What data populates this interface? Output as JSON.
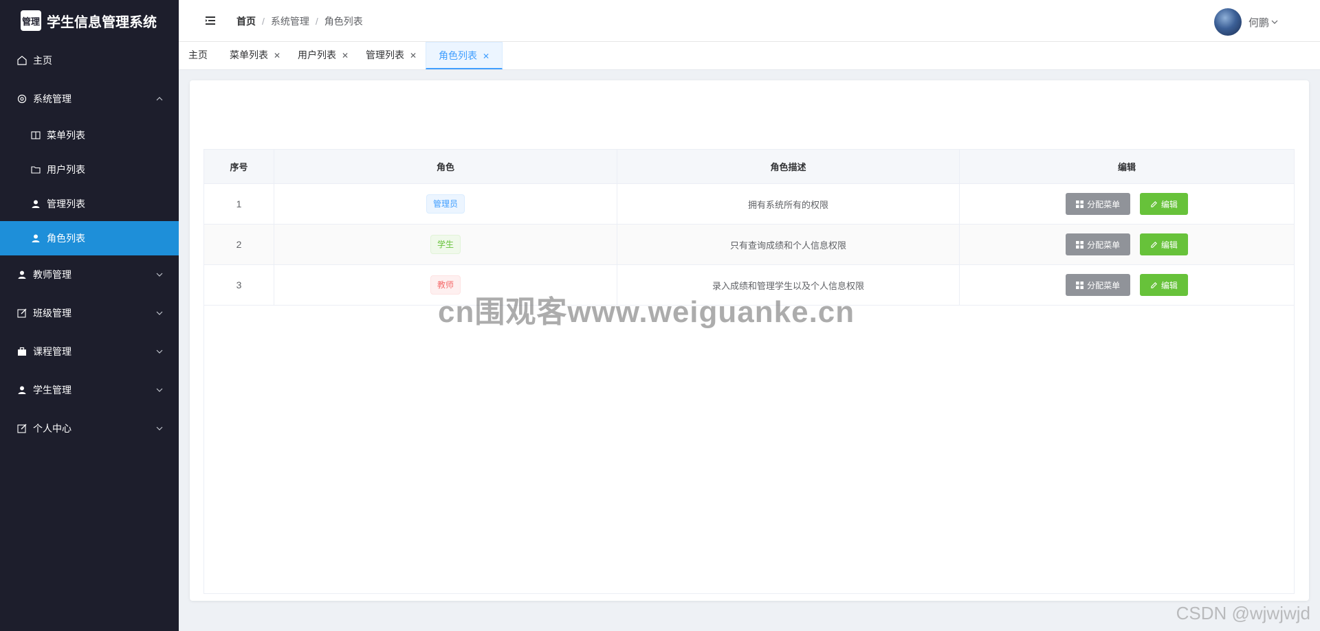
{
  "brand": {
    "logo_text": "管理",
    "title": "学生信息管理系统"
  },
  "sidebar": {
    "home": "主页",
    "system": {
      "label": "系统管理",
      "children": [
        "菜单列表",
        "用户列表",
        "管理列表",
        "角色列表"
      ]
    },
    "groups": [
      "教师管理",
      "班级管理",
      "课程管理",
      "学生管理",
      "个人中心"
    ]
  },
  "breadcrumb": [
    "首页",
    "系统管理",
    "角色列表"
  ],
  "user": {
    "name": "何鹏"
  },
  "tabs": [
    {
      "label": "主页",
      "closable": false
    },
    {
      "label": "菜单列表",
      "closable": true
    },
    {
      "label": "用户列表",
      "closable": true
    },
    {
      "label": "管理列表",
      "closable": true
    },
    {
      "label": "角色列表",
      "closable": true,
      "active": true
    }
  ],
  "table": {
    "headers": [
      "序号",
      "角色",
      "角色描述",
      "编辑"
    ],
    "rows": [
      {
        "index": "1",
        "role": "管理员",
        "tag_type": "primary",
        "description": "拥有系统所有的权限"
      },
      {
        "index": "2",
        "role": "学生",
        "tag_type": "success",
        "description": "只有查询成绩和个人信息权限"
      },
      {
        "index": "3",
        "role": "教师",
        "tag_type": "danger",
        "description": "录入成绩和管理学生以及个人信息权限"
      }
    ],
    "assign_label": "分配菜单",
    "edit_label": "编辑"
  },
  "colors": {
    "sidebar_bg": "#1d1e2c",
    "active_item": "#1e8fd9",
    "assign_btn": "#909399",
    "edit_btn": "#67c23a"
  },
  "watermark": "cn围观客www.weiguanke.cn",
  "csdn_mark": "CSDN @wjwjwjd"
}
